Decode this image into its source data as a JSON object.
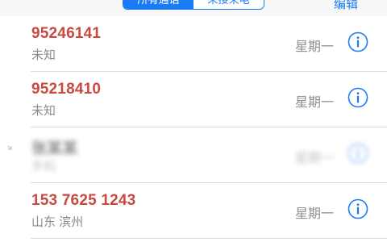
{
  "header": {
    "segments": [
      {
        "label": "所有通话",
        "active": true
      },
      {
        "label": "未接来电",
        "active": false
      }
    ],
    "edit_label": "编辑"
  },
  "calls": [
    {
      "number": "95246141",
      "location": "未知",
      "day": "星期一",
      "blurred": false
    },
    {
      "number": "95218410",
      "location": "未知",
      "day": "星期一",
      "blurred": false
    },
    {
      "number": "张某某",
      "location": "手机",
      "day": "星期一",
      "blurred": true
    },
    {
      "number": "153 7625 1243",
      "location": "山东 滨州",
      "day": "星期一",
      "blurred": false
    }
  ],
  "icons": {
    "info": "info-circle-icon",
    "outgoing": "phone-outgoing-icon"
  },
  "colors": {
    "accent": "#1a7cf5",
    "missed_call": "#c8493f",
    "secondary_text": "#8a8a8a"
  }
}
